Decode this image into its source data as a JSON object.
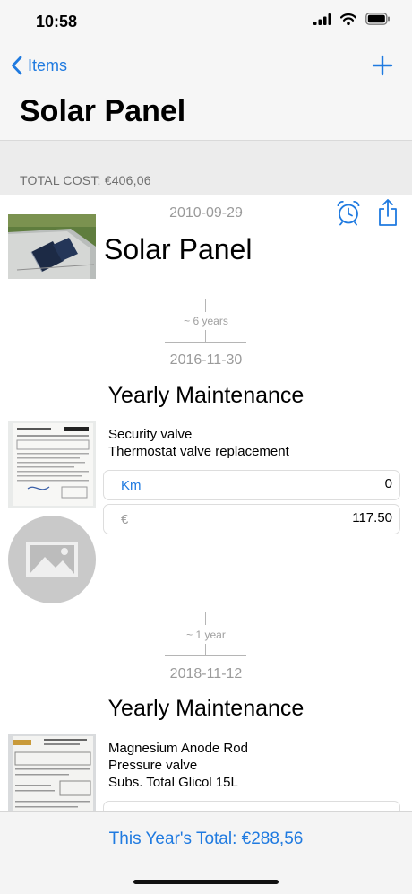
{
  "status_bar": {
    "time": "10:58",
    "icons": [
      "signal-icon",
      "wifi-icon",
      "battery-icon"
    ]
  },
  "nav": {
    "back_label": "Items",
    "title": "Solar Panel",
    "add_icon": "plus-icon"
  },
  "total_cost": "TOTAL COST: €406,06",
  "item": {
    "date": "2010-09-29",
    "name": "Solar Panel",
    "actions": [
      "alarm-clock-icon",
      "share-icon"
    ]
  },
  "entries": [
    {
      "gap": "~ 6 years",
      "date": "2016-11-30",
      "title": "Yearly Maintenance",
      "description": [
        "Security valve",
        "Thermostat valve replacement"
      ],
      "km_label": "Km",
      "km_value": "0",
      "cost_label": "€",
      "cost_value": "117.50"
    },
    {
      "gap": "~ 1 year",
      "date": "2018-11-12",
      "title": "Yearly Maintenance",
      "description": [
        "Magnesium Anode Rod",
        "Pressure valve",
        "Subs. Total Glicol 15L"
      ]
    }
  ],
  "footer": {
    "year_total": "This Year's Total: €288,56"
  },
  "colors": {
    "accent": "#1f7ae0",
    "nav_background": "#f6f6f6",
    "section_header": "#ececec"
  }
}
